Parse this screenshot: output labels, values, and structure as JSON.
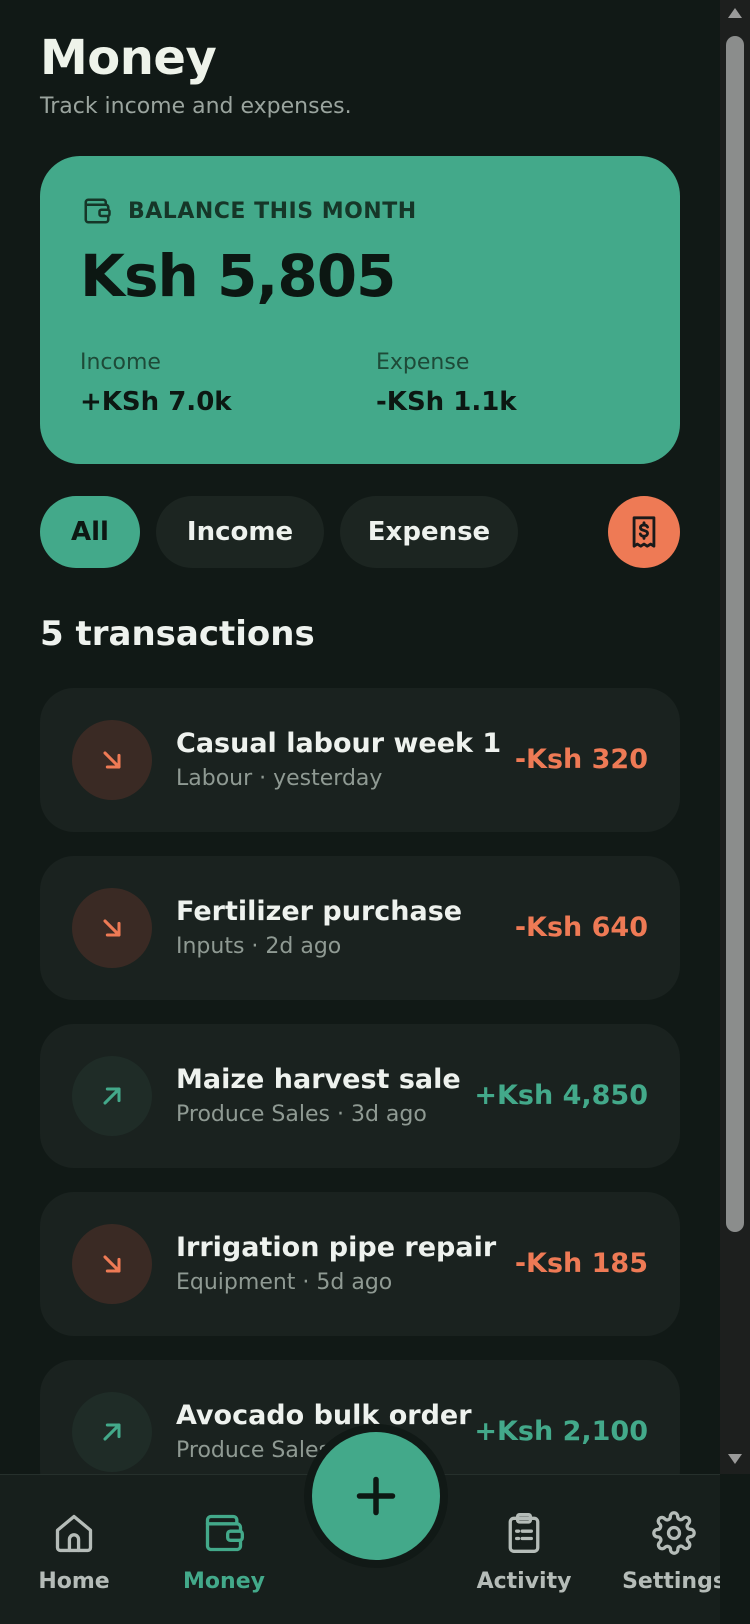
{
  "header": {
    "title": "Money",
    "subtitle": "Track income and expenses."
  },
  "balance": {
    "label": "BALANCE THIS MONTH",
    "amount": "Ksh 5,805",
    "income_label": "Income",
    "income_value": "+KSh 7.0k",
    "expense_label": "Expense",
    "expense_value": "-KSh 1.1k",
    "icon": "wallet-icon"
  },
  "filters": {
    "items": [
      {
        "label": "All",
        "active": true
      },
      {
        "label": "Income",
        "active": false
      },
      {
        "label": "Expense",
        "active": false
      }
    ],
    "receipt_icon": "receipt-icon"
  },
  "transactions": {
    "count_label": "5 transactions",
    "items": [
      {
        "title": "Casual labour week 1",
        "meta": "Labour · yesterday",
        "amount": "-Ksh 320",
        "type": "expense"
      },
      {
        "title": "Fertilizer purchase",
        "meta": "Inputs · 2d ago",
        "amount": "-Ksh 640",
        "type": "expense"
      },
      {
        "title": "Maize harvest sale",
        "meta": "Produce Sales · 3d ago",
        "amount": "+Ksh 4,850",
        "type": "income"
      },
      {
        "title": "Irrigation pipe repair",
        "meta": "Equipment · 5d ago",
        "amount": "-Ksh 185",
        "type": "expense"
      },
      {
        "title": "Avocado bulk order",
        "meta": "Produce Sales",
        "amount": "+Ksh 2,100",
        "type": "income"
      }
    ]
  },
  "nav": {
    "items": [
      {
        "label": "Home",
        "icon": "home-icon"
      },
      {
        "label": "Money",
        "icon": "wallet-icon",
        "active": true
      },
      {
        "label": "Activity",
        "icon": "clipboard-icon"
      },
      {
        "label": "Settings",
        "icon": "gear-icon"
      }
    ],
    "fab_icon": "plus-icon"
  },
  "colors": {
    "background": "#111916",
    "accent": "#43a98a",
    "expense": "#ee7a55",
    "card": "#1a221f"
  }
}
